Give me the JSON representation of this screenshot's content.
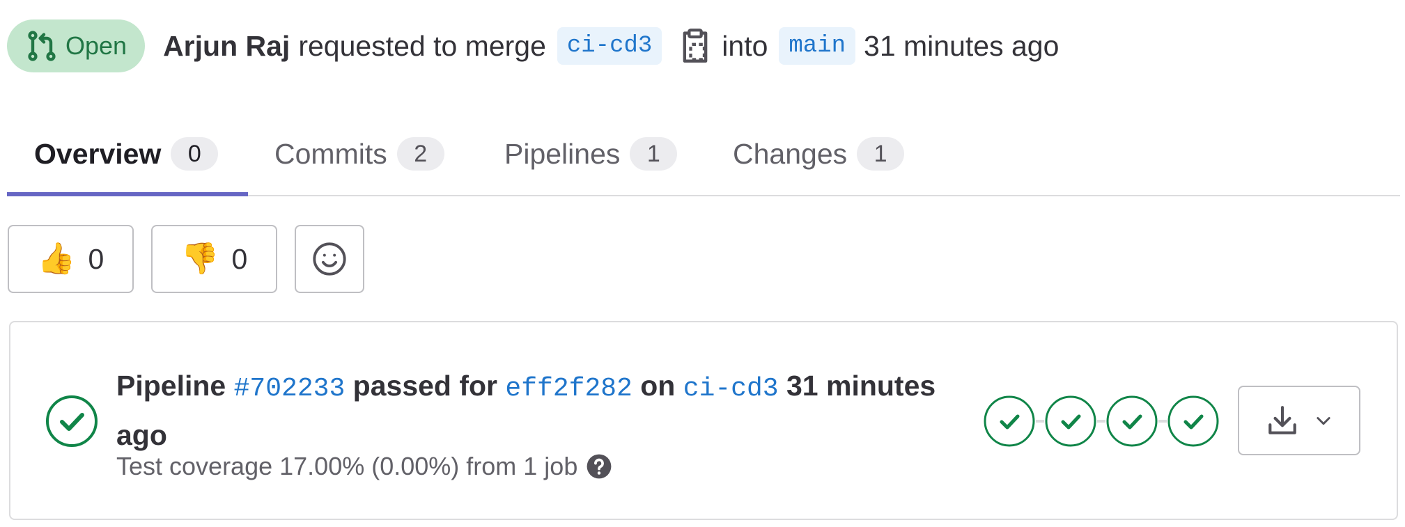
{
  "header": {
    "status": "Open",
    "author": "Arjun Raj",
    "action_text": "requested to merge",
    "source_branch": "ci-cd3",
    "into_text": "into",
    "target_branch": "main",
    "time_ago": "31 minutes ago"
  },
  "tabs": [
    {
      "label": "Overview",
      "count": "0"
    },
    {
      "label": "Commits",
      "count": "2"
    },
    {
      "label": "Pipelines",
      "count": "1"
    },
    {
      "label": "Changes",
      "count": "1"
    }
  ],
  "awards": {
    "thumbs_up": {
      "emoji": "👍",
      "count": "0"
    },
    "thumbs_down": {
      "emoji": "👎",
      "count": "0"
    },
    "add_reaction_icon": "smiley-icon"
  },
  "pipeline": {
    "word": "Pipeline",
    "id": "#702233",
    "passed_for": "passed for",
    "commit_sha": "eff2f282",
    "on_text": "on",
    "branch": "ci-cd3",
    "time_ago": "31 minutes ago",
    "coverage_text": "Test coverage 17.00% (0.00%) from 1 job",
    "stages": [
      "passed",
      "passed",
      "passed",
      "passed"
    ],
    "artifacts_icon": "download-icon"
  },
  "colors": {
    "success": "#108548",
    "link": "#1f75cb",
    "tab_underline": "#6666c4",
    "status_pill_bg": "#c3e6cd"
  }
}
